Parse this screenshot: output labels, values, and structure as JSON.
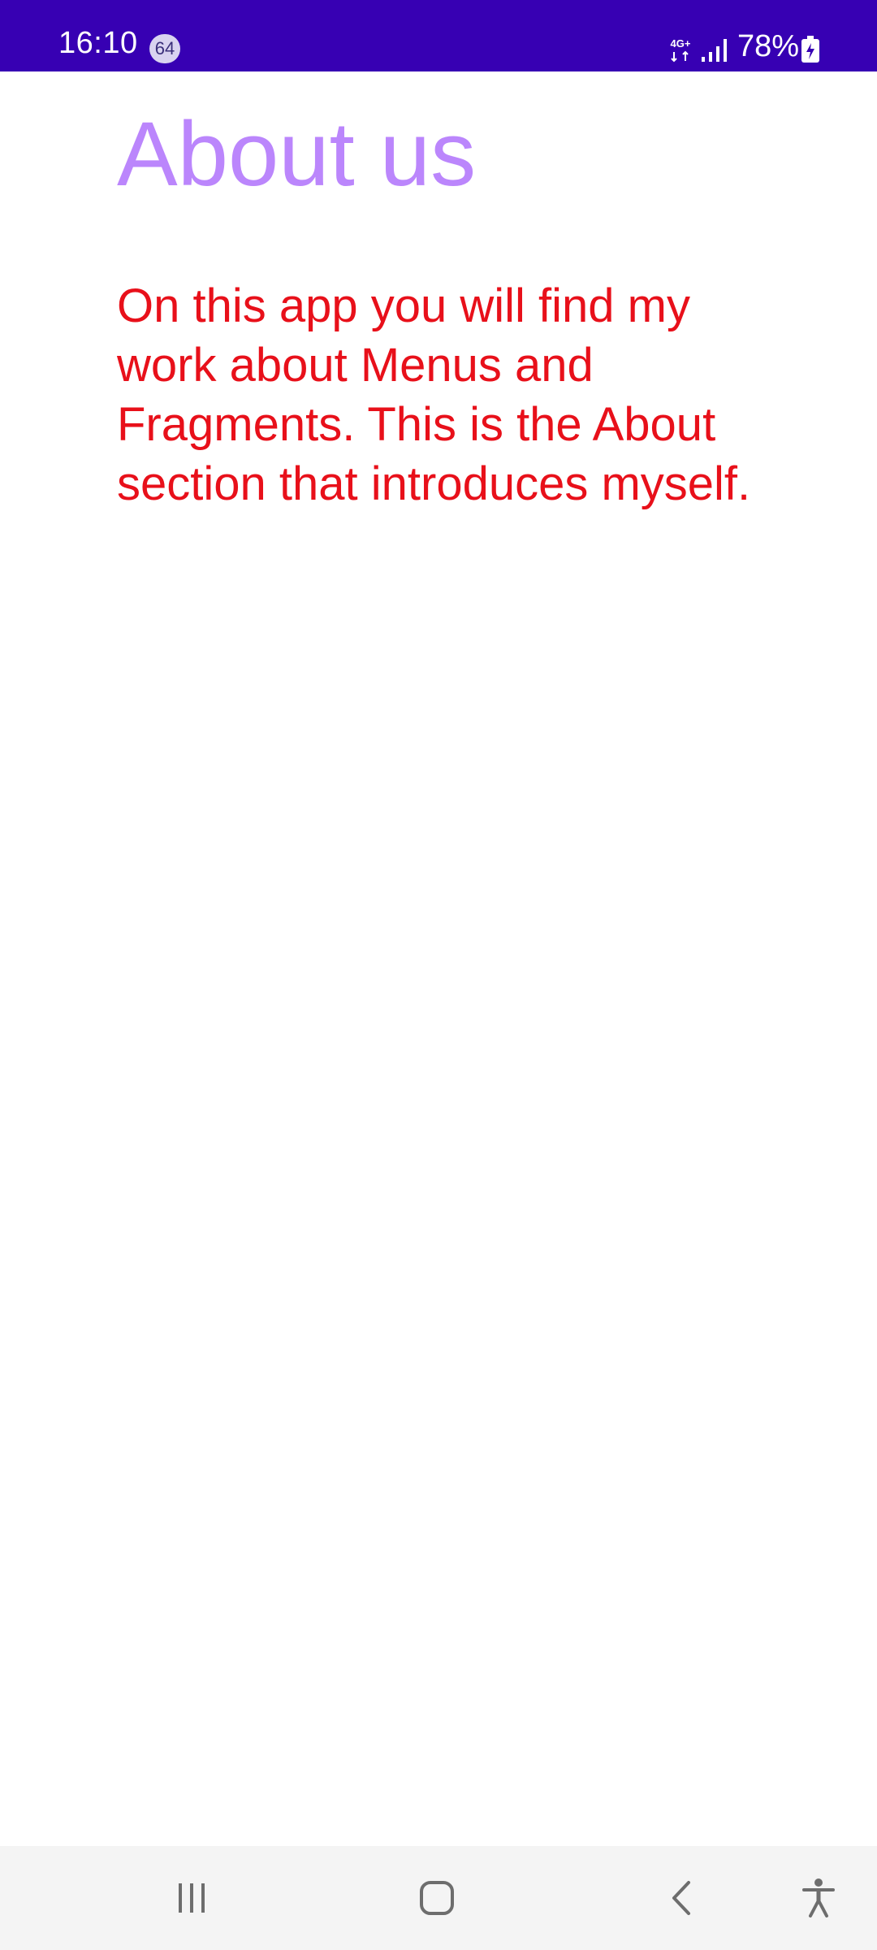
{
  "status_bar": {
    "time": "16:10",
    "notification_count": "64",
    "network_type": "4G+",
    "battery_percent": "78%",
    "background_color": "#3700B3"
  },
  "page": {
    "title": "About us",
    "body": "On this app you will find my work about Menus and Fragments. This is the About section that introduces myself.",
    "title_color": "#BB86FC",
    "body_color": "#E8101A"
  },
  "nav_bar": {
    "icons": [
      "recent-apps-icon",
      "home-icon",
      "back-icon",
      "accessibility-icon"
    ]
  }
}
